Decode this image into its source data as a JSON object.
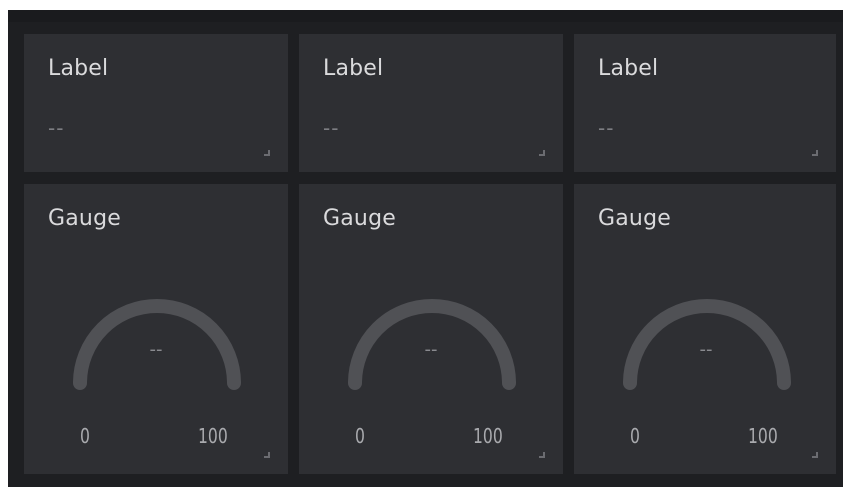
{
  "dashboard": {
    "label_widgets": [
      {
        "title": "Label",
        "value": "--"
      },
      {
        "title": "Label",
        "value": "--"
      },
      {
        "title": "Label",
        "value": "--"
      }
    ],
    "gauge_widgets": [
      {
        "title": "Gauge",
        "value": "--",
        "min": "0",
        "max": "100"
      },
      {
        "title": "Gauge",
        "value": "--",
        "min": "0",
        "max": "100"
      },
      {
        "title": "Gauge",
        "value": "--",
        "min": "0",
        "max": "100"
      }
    ],
    "icons": {
      "resize_handle": "resize-corner-icon"
    },
    "colors": {
      "background": "#1e1f22",
      "widget": "#2e2f33",
      "gauge_track": "#505155",
      "title_text": "#dadadc",
      "muted_text": "#7d7e83"
    }
  }
}
